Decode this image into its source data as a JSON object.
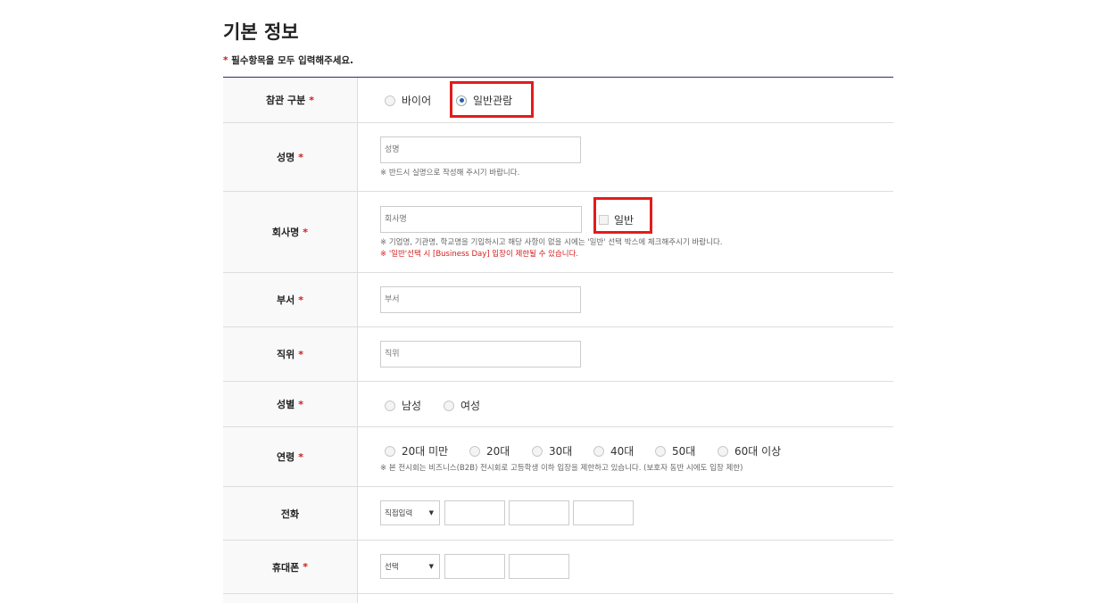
{
  "page": {
    "title": "기본 정보",
    "required_star": "*",
    "required_note": "필수항목을 모두 입력해주세요."
  },
  "form": {
    "visitor_type": {
      "label": "참관 구분",
      "options": [
        "바이어",
        "일반관람"
      ],
      "selected": "일반관람"
    },
    "name": {
      "label": "성명",
      "placeholder": "성명",
      "help": "※ 반드시 실명으로 작성해 주시기 바랍니다."
    },
    "company": {
      "label": "회사명",
      "placeholder": "회사명",
      "checkbox_label": "일반",
      "help": "※ 기업명, 기관명, 학교명을 기입하시고 해당 사항이 없을 시에는 '일반' 선택 박스에 체크해주시기 바랍니다.",
      "warning": "※ '일반'선택 시 [Business Day] 입장이 제한될 수 있습니다."
    },
    "department": {
      "label": "부서",
      "placeholder": "부서"
    },
    "position": {
      "label": "직위",
      "placeholder": "직위"
    },
    "gender": {
      "label": "성별",
      "options": [
        "남성",
        "여성"
      ]
    },
    "age": {
      "label": "연령",
      "options": [
        "20대 미만",
        "20대",
        "30대",
        "40대",
        "50대",
        "60대 이상"
      ],
      "help": "※ 본 전시회는 비즈니스(B2B) 전시회로 고등학생 이하 입장을 제한하고 있습니다. (보호자 동반 시에도 입장 제한)"
    },
    "phone": {
      "label": "전화",
      "select_value": "직접입력"
    },
    "mobile": {
      "label": "휴대폰",
      "select_value": "선택"
    }
  },
  "colors": {
    "accent_line": "#2b2f66",
    "required": "#c81e1e",
    "highlight": "#e21c1c"
  }
}
